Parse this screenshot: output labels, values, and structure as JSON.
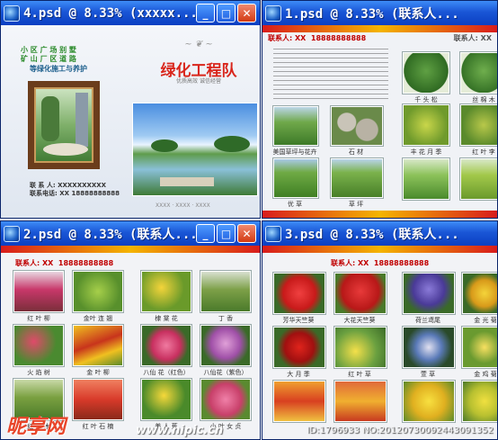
{
  "windows": {
    "w4": {
      "title": "4.psd @ 8.33% (xxxxx..."
    },
    "w1": {
      "title": "1.psd @ 8.33% (联系人..."
    },
    "w2": {
      "title": "2.psd @ 8.33% (联系人..."
    },
    "w3": {
      "title": "3.psd @ 8.33% (联系人..."
    }
  },
  "buttons": {
    "minimize": "_",
    "maximize": "□",
    "close": "✕"
  },
  "cover": {
    "services": [
      "小 区   广 场   别 墅",
      "矿 山   厂 区   道 路"
    ],
    "services_sub": "等绿化施工与养护",
    "team_title": "绿化工程队",
    "team_sub": "优质高效 诚信经营",
    "contact_name": "联 系 人: XXXXXXXXXX",
    "contact_phone": "联系电话: XX   18888888888",
    "footer": "XXXX · XXXX · XXXX"
  },
  "contact_bar": {
    "person": "联系人: XX",
    "phone": "18888888888"
  },
  "page1": {
    "captions": [
      "美国草坪与花卉",
      "石  材",
      "千 头 松",
      "丝 棉 木",
      "优  草",
      "草  坪",
      "丰 花 月 季",
      "红 叶 李"
    ]
  },
  "page2": {
    "captions": [
      "红 叶 柳",
      "金叶 连 翘",
      "棣 棠 花",
      "丁 香",
      "火 焰 树",
      "金 叶 柳",
      "八仙 花（红色）",
      "八仙花（紫色）",
      "红 瑞 木",
      "红 叶 石 楠",
      "美 人 蕉",
      "小 叶 女 贞"
    ]
  },
  "page3": {
    "captions": [
      "芳华天竺葵",
      "大花天竺葵",
      "荷兰鸢尾",
      "金 光 菊",
      "大 月 季",
      "红 叶 草",
      "萱 草",
      "金 鸡 菊"
    ]
  },
  "watermark": {
    "brand": "昵享网",
    "url": "www.nipic.cn",
    "id": "ID:1796933 NO:20120730092443091352"
  }
}
